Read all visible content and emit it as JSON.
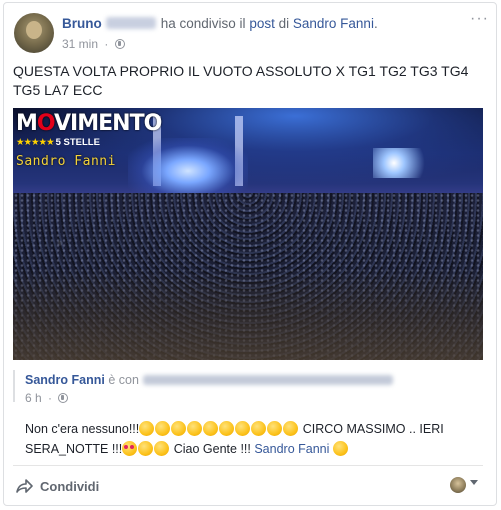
{
  "header": {
    "author_first_name": "Bruno",
    "shared_text": "ha condiviso il",
    "post_link": "post",
    "of_text": "di",
    "page_name": "Sandro Fanni",
    "end_punct": ".",
    "time": "31 min",
    "separator": "·",
    "privacy_icon": "globe-icon"
  },
  "post": {
    "text_line_1": "QUESTA VOLTA PROPRIO IL VUOTO ASSOLUTO X TG1 TG2 TG3 TG4",
    "text_line_2": "TG5 LA7 ECC"
  },
  "photo": {
    "logo_text_start": "M",
    "logo_text_o": "O",
    "logo_text_end": "VIMENTO",
    "logo_stars": "★★★★★",
    "logo_sub": "5 STELLE",
    "watermark": "Sandro Fanni"
  },
  "shared_post": {
    "author": "Sandro Fanni",
    "with_text": "è con",
    "time": "6 h",
    "separator": "·",
    "body_1": "Non c'era nessuno!!!",
    "body_2": "CIRCO MASSIMO .. IERI",
    "body_3": "SERA_NOTTE !!!",
    "body_4": "Ciao Gente !!!",
    "mention": "Sandro Fanni"
  },
  "footer": {
    "share_label": "Condividi",
    "share_icon": "share-arrow-icon"
  },
  "colors": {
    "link": "#365899",
    "muted": "#90949c",
    "text": "#1d2129"
  }
}
